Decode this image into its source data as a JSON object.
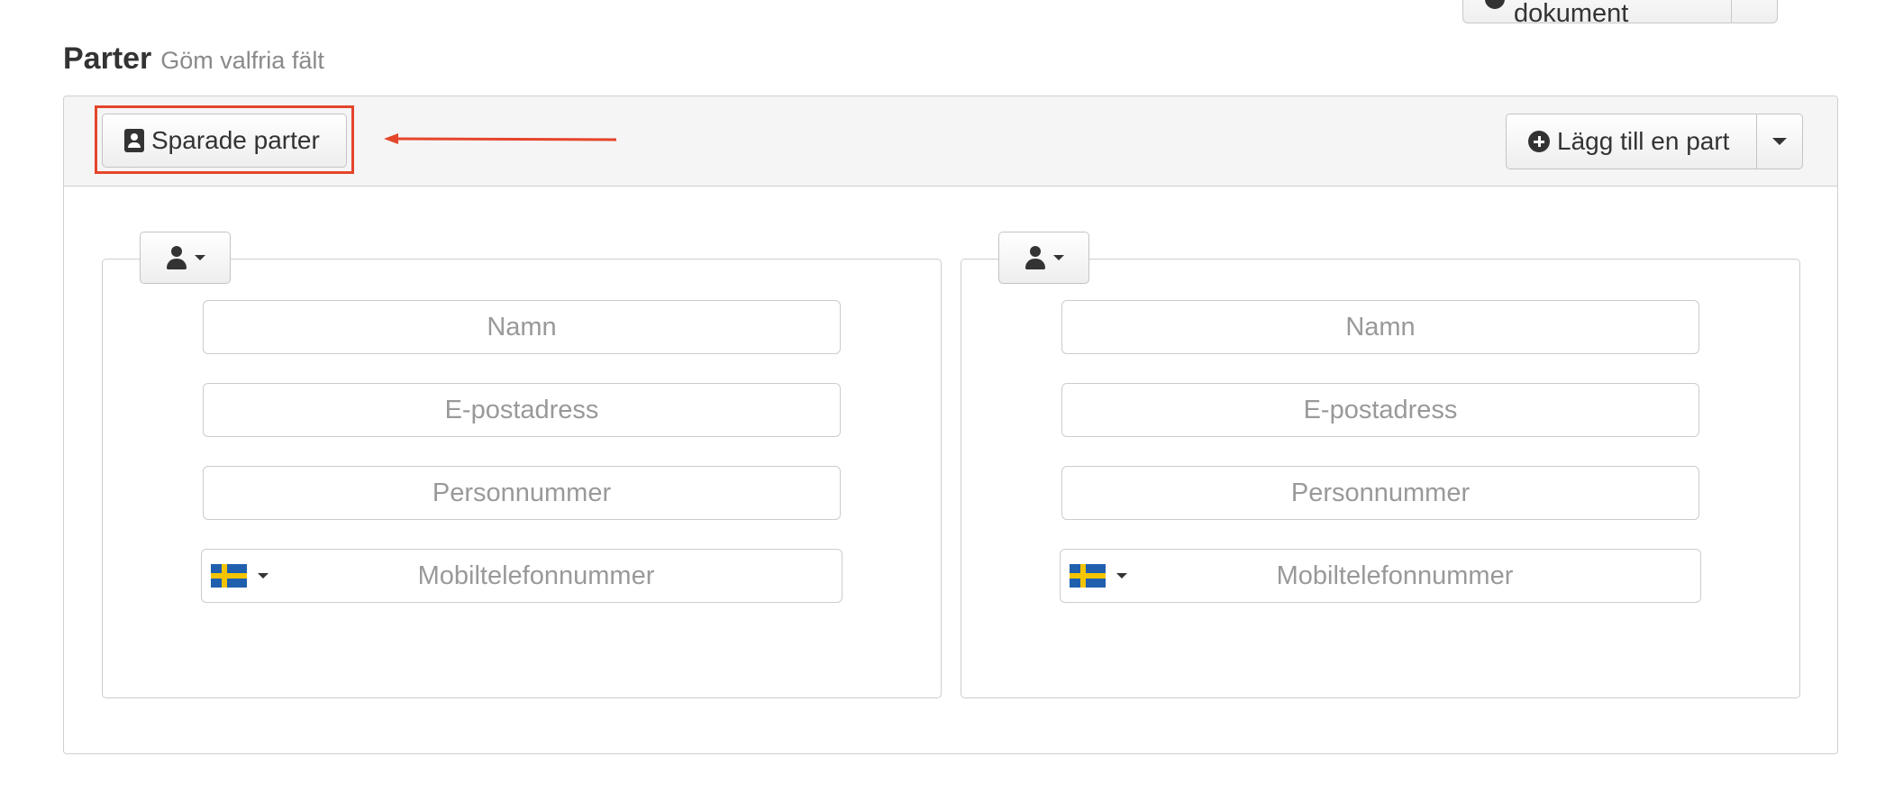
{
  "top_button": {
    "label": "Lägg till fler dokument"
  },
  "section": {
    "title": "Parter",
    "subtitle": "Göm valfria fält"
  },
  "toolbar": {
    "saved_parties_label": "Sparade parter",
    "add_party_label": "Lägg till en part"
  },
  "annotation": {
    "color": "#e5452a"
  },
  "parties": [
    {
      "name_placeholder": "Namn",
      "email_placeholder": "E-postadress",
      "personal_number_placeholder": "Personnummer",
      "phone_placeholder": "Mobiltelefonnummer",
      "country_flag": "sweden-flag"
    },
    {
      "name_placeholder": "Namn",
      "email_placeholder": "E-postadress",
      "personal_number_placeholder": "Personnummer",
      "phone_placeholder": "Mobiltelefonnummer",
      "country_flag": "sweden-flag"
    }
  ]
}
